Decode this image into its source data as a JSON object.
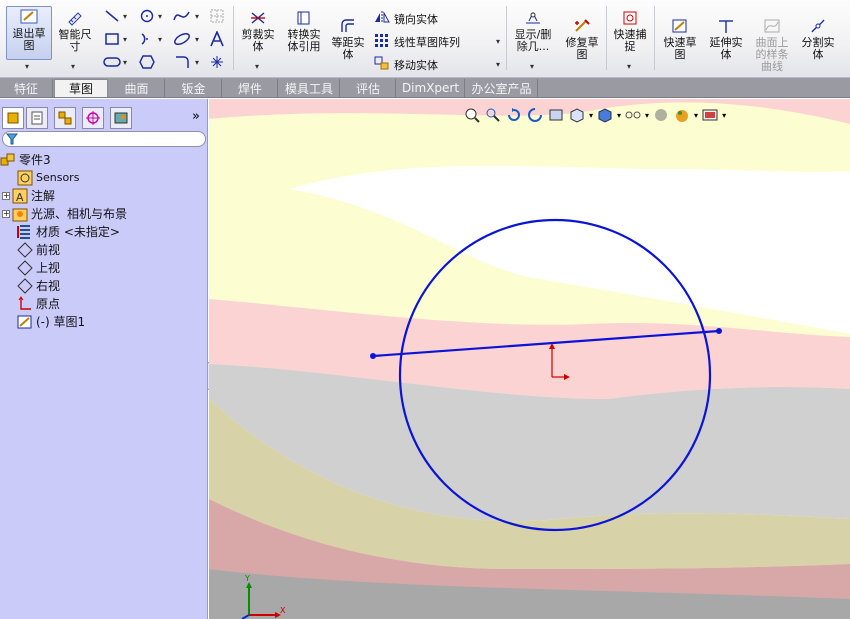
{
  "ribbon": {
    "exit_sketch": "退出草\n图",
    "smart_dimension": "智能尺\n寸",
    "trim_entities": "剪裁实\n体",
    "convert_entities": "转换实\n体引用",
    "offset_entities": "等距实\n体",
    "mirror_entities": "镜向实体",
    "linear_pattern": "线性草图阵列",
    "move_entities": "移动实体",
    "display_delete_relations": "显示/删\n除几...",
    "repair_sketch": "修复草\n图",
    "quick_snaps": "快速捕\n捉",
    "rapid_sketch": "快速草\n图",
    "extend_entities": "延伸实\n体",
    "surface_spline": "曲面上\n的样条\n曲线",
    "split_entities": "分割实\n体"
  },
  "tabs": [
    "特征",
    "草图",
    "曲面",
    "钣金",
    "焊件",
    "模具工具",
    "评估",
    "DimXpert",
    "办公室产品"
  ],
  "active_tab": "草图",
  "tree": {
    "root": "零件3",
    "items": [
      "Sensors",
      "注解",
      "光源、相机与布景",
      "材质 <未指定>",
      "前视",
      "上视",
      "右视",
      "原点",
      "(-) 草图1"
    ]
  },
  "triad": {
    "y": "Y",
    "x": "X"
  },
  "colors": {
    "ribbon_bg": "#f1f1f3",
    "tree_bg": "#cbcbfa",
    "sketch_line": "#0a14d8",
    "origin": "#d00000"
  },
  "icons": [
    "exit-sketch-icon",
    "smart-dimension-icon",
    "line-icon",
    "circle-icon",
    "spline-icon",
    "rectangle-icon",
    "arc-icon",
    "ellipse-icon",
    "text-icon",
    "point-icon",
    "trim-icon",
    "convert-icon",
    "offset-icon",
    "mirror-icon",
    "pattern-icon",
    "move-icon",
    "relations-icon",
    "repair-icon",
    "snap-icon",
    "rapid-sketch-icon",
    "extend-icon",
    "split-icon"
  ]
}
